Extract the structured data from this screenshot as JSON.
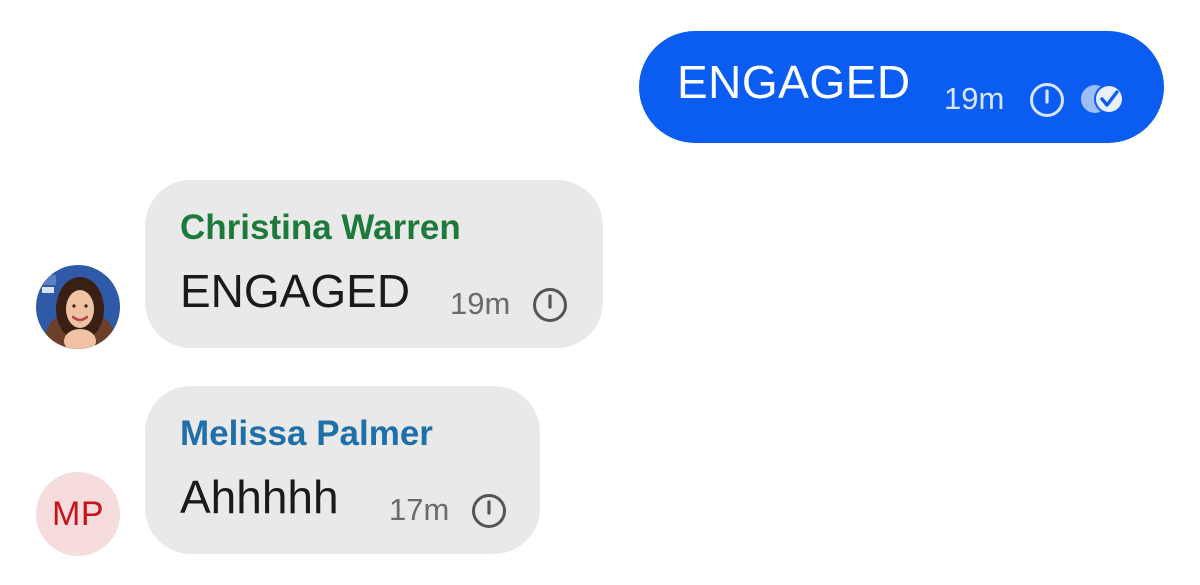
{
  "colors": {
    "outgoing_bubble": "#0b5cf1",
    "incoming_bubble": "#e9e9e9",
    "sender_christina": "#1e7a3a",
    "sender_melissa": "#1f6fa8",
    "initials_bg": "#f6dcdc",
    "initials_fg": "#c4141a"
  },
  "messages": [
    {
      "direction": "outgoing",
      "text": "ENGAGED",
      "time": "19m",
      "status_icons": [
        "clock-icon",
        "read-check-icon"
      ]
    },
    {
      "direction": "incoming",
      "sender": "Christina Warren",
      "avatar": "photo",
      "text": "ENGAGED",
      "time": "19m",
      "status_icons": [
        "clock-icon"
      ]
    },
    {
      "direction": "incoming",
      "sender": "Melissa Palmer",
      "avatar_initials": "MP",
      "text": "Ahhhhh",
      "time": "17m",
      "status_icons": [
        "clock-icon"
      ]
    }
  ]
}
